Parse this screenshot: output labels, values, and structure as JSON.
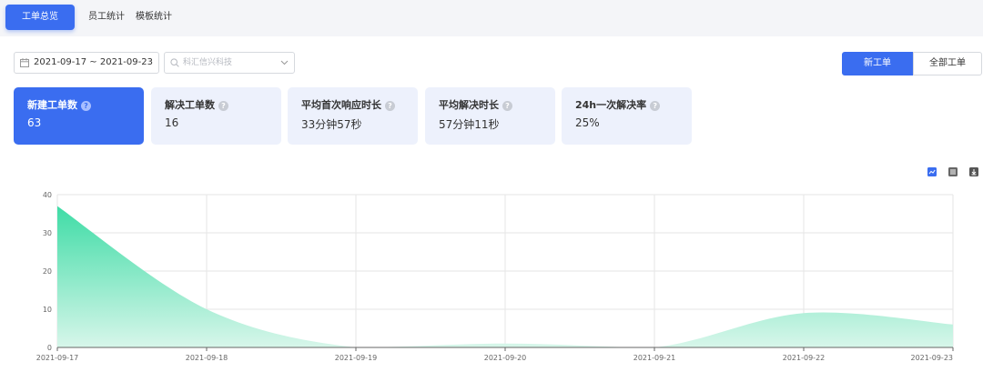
{
  "tabs": [
    {
      "label": "工单总览",
      "active": true
    },
    {
      "label": "员工统计",
      "active": false
    },
    {
      "label": "模板统计",
      "active": false
    }
  ],
  "filters": {
    "date_range": "2021-09-17 ~ 2021-09-23",
    "company_placeholder": "科汇信兴科技"
  },
  "toggle": {
    "new_label": "新工单",
    "all_label": "全部工单"
  },
  "cards": [
    {
      "label": "新建工单数",
      "value": "63"
    },
    {
      "label": "解决工单数",
      "value": "16"
    },
    {
      "label": "平均首次响应时长",
      "value": "33分钟57秒"
    },
    {
      "label": "平均解决时长",
      "value": "57分钟11秒"
    },
    {
      "label": "24h一次解决率",
      "value": "25%"
    }
  ],
  "colors": {
    "accent": "#3a6df0",
    "area_top": "#3fdca6",
    "area_bottom": "#d7f6ea"
  },
  "icons": [
    "line-chart-icon",
    "table-view-icon",
    "download-icon",
    "calendar-icon",
    "search-icon",
    "chevron-down-icon",
    "help-icon"
  ],
  "chart_data": {
    "type": "area",
    "x": [
      "2021-09-17",
      "2021-09-18",
      "2021-09-19",
      "2021-09-20",
      "2021-09-21",
      "2021-09-22",
      "2021-09-23"
    ],
    "values": [
      37,
      10,
      0,
      1,
      0,
      9,
      6
    ],
    "ylim": [
      0,
      40
    ],
    "yticks": [
      0,
      10,
      20,
      30,
      40
    ],
    "grid": true,
    "smooth": true
  }
}
